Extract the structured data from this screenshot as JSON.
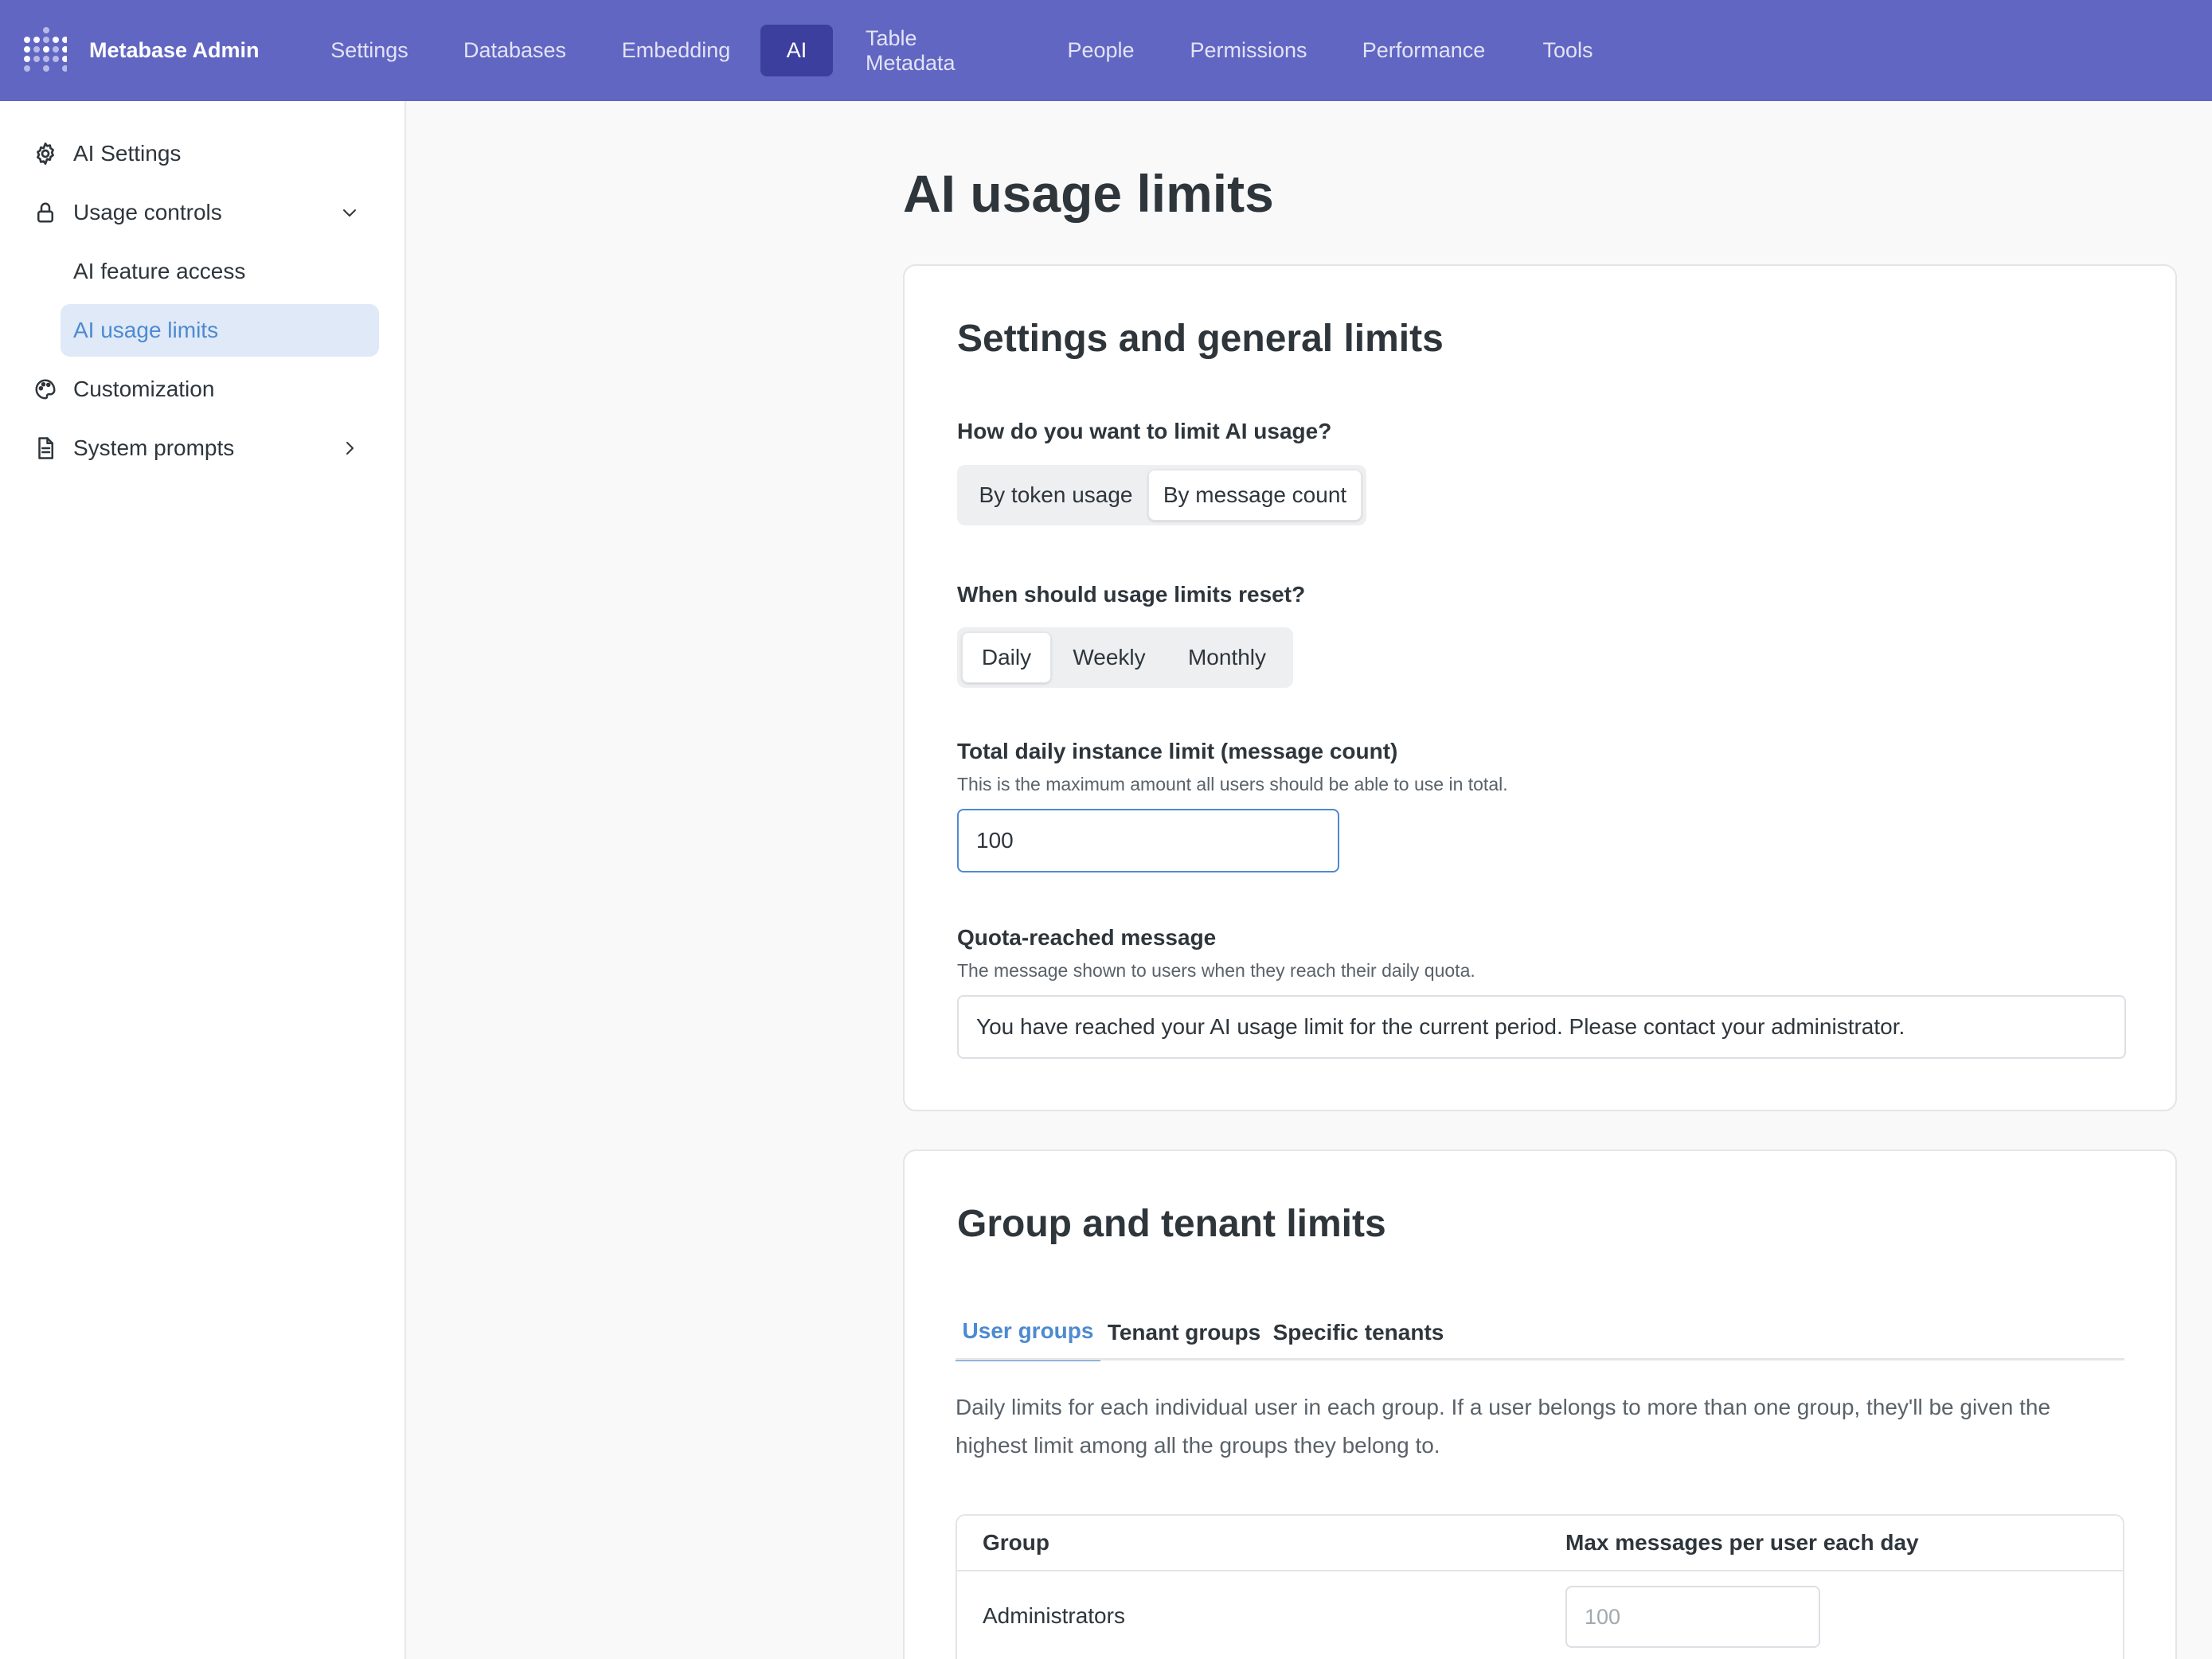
{
  "app": {
    "brand": "Metabase Admin",
    "accent_color": "#6166c3"
  },
  "topnav": {
    "tabs": [
      {
        "label": "Settings",
        "active": false
      },
      {
        "label": "Databases",
        "active": false
      },
      {
        "label": "Embedding",
        "active": false
      },
      {
        "label": "AI",
        "active": true
      },
      {
        "label": "Table Metadata",
        "active": false
      },
      {
        "label": "People",
        "active": false
      },
      {
        "label": "Permissions",
        "active": false
      },
      {
        "label": "Performance",
        "active": false
      },
      {
        "label": "Tools",
        "active": false
      }
    ]
  },
  "sidebar": {
    "items": [
      {
        "label": "AI Settings",
        "icon": "gear-icon"
      },
      {
        "label": "Usage controls",
        "icon": "lock-icon",
        "expanded": true,
        "children": [
          {
            "label": "AI feature access",
            "active": false
          },
          {
            "label": "AI usage limits",
            "active": true
          }
        ]
      },
      {
        "label": "Customization",
        "icon": "palette-icon"
      },
      {
        "label": "System prompts",
        "icon": "document-icon",
        "expanded": false
      }
    ]
  },
  "main": {
    "title": "AI usage limits",
    "general": {
      "title": "Settings and general limits",
      "limit_by": {
        "label": "How do you want to limit AI usage?",
        "options": [
          "By token usage",
          "By message count"
        ],
        "selected": "By message count"
      },
      "reset": {
        "label": "When should usage limits reset?",
        "options": [
          "Daily",
          "Weekly",
          "Monthly"
        ],
        "selected": "Daily"
      },
      "instance_limit": {
        "label": "Total daily instance limit (message count)",
        "hint": "This is the maximum amount all users should be able to use in total.",
        "value": "100"
      },
      "quota_message": {
        "label": "Quota-reached message",
        "hint": "The message shown to users when they reach their daily quota.",
        "value": "You have reached your AI usage limit for the current period. Please contact your administrator."
      }
    },
    "groups": {
      "title": "Group and tenant limits",
      "tabs": [
        {
          "label": "User groups",
          "active": true
        },
        {
          "label": "Tenant groups",
          "active": false
        },
        {
          "label": "Specific tenants",
          "active": false
        }
      ],
      "description": "Daily limits for each individual user in each group. If a user belongs to more than one group, they'll be given the highest limit among all the groups they belong to.",
      "table": {
        "columns": [
          "Group",
          "Max messages per user each day"
        ],
        "rows": [
          {
            "group": "Administrators",
            "placeholder": "100"
          }
        ]
      }
    }
  }
}
